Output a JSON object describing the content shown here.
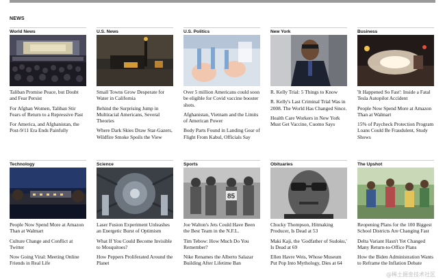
{
  "page": {
    "section_title": "NEWS",
    "watermark": "@稀土掘金技术社区"
  },
  "columns_row1": [
    {
      "category": "World News",
      "image_icon": "concert-crowd-photo",
      "headlines": [
        "Taliban Promise Peace, but Doubt and Fear Persist",
        "For Afghan Women, Taliban Stir Fears of Return to a Repressive Past",
        "For America, and Afghanistan, the Post-9/11 Era Ends Painfully"
      ]
    },
    {
      "category": "U.S. News",
      "image_icon": "night-town-photo",
      "headlines": [
        "Small Towns Grow Desperate for Water in California",
        "Behind the Surprising Jump in Multiracial Americans, Several Theories",
        "Where Dark Skies Draw Star-Gazers, Wildfire Smoke Spoils the View"
      ]
    },
    {
      "category": "U.S. Politics",
      "image_icon": "vaccine-vials-photo",
      "headlines": [
        "Over 5 million Americans could soon be eligible for Covid vaccine booster shots.",
        "Afghanistan, Vietnam and the Limits of American Power",
        "Body Parts Found in Landing Gear of Flight From Kabul, Officials Say"
      ]
    },
    {
      "category": "New York",
      "image_icon": "courtroom-portrait-photo",
      "headlines": [
        "R. Kelly Trial: 5 Things to Know",
        "R. Kelly's Last Criminal Trial Was in 2008. The World Has Changed Since.",
        "Health Care Workers in New York Must Get Vaccine, Cuomo Says"
      ]
    },
    {
      "category": "Business",
      "image_icon": "crash-scene-photo",
      "headlines": [
        "'It Happened So Fast': Inside a Fatal Tesla Autopilot Accident",
        "People Now Spend More at Amazon Than at Walmart",
        "15% of Paycheck Protection Program Loans Could Be Fraudulent, Study Shows"
      ]
    }
  ],
  "columns_row2": [
    {
      "category": "Technology",
      "image_icon": "warehouse-dusk-photo",
      "headlines": [
        "People Now Spend More at Amazon Than at Walmart",
        "Culture Change and Conflict at Twitter",
        "Now Going Viral: Meeting Online Friends in Real Life"
      ]
    },
    {
      "category": "Science",
      "image_icon": "laser-chamber-photo",
      "headlines": [
        "Laser Fusion Experiment Unleashes an Energetic Burst of Optimism",
        "What If You Could Become Invisible to Mosquitoes?",
        "How Peppers Proliferated Around the Planet"
      ]
    },
    {
      "category": "Sports",
      "image_icon": "football-team-photo",
      "headlines": [
        "Joe Walton's Jets Could Have Been the Best Team in the N.F.L.",
        "Tim Tebow: How Much Do You Remember?",
        "Nike Renames the Alberto Salazar Building After Lifetime Ban"
      ]
    },
    {
      "category": "Obituaries",
      "image_icon": "man-glasses-portrait-photo",
      "headlines": [
        "Chucky Thompson, Hitmaking Producer, Is Dead at 53",
        "Maki Kaji, the 'Godfather of Sudoku,' Is Dead at 69",
        "Ellen Havre Weis, Whose Museum Put Pop Into Mythology, Dies at 64"
      ]
    },
    {
      "category": "The Upshot",
      "image_icon": "family-outdoors-photo",
      "headlines": [
        "Reopening Plans for the 100 Biggest School Districts Are Changing Fast",
        "Delta Variant Hasn't Yet Changed Many Return-to-Office Plans",
        "How the Biden Administration Wants to Reframe the Inflation Debate"
      ]
    }
  ]
}
